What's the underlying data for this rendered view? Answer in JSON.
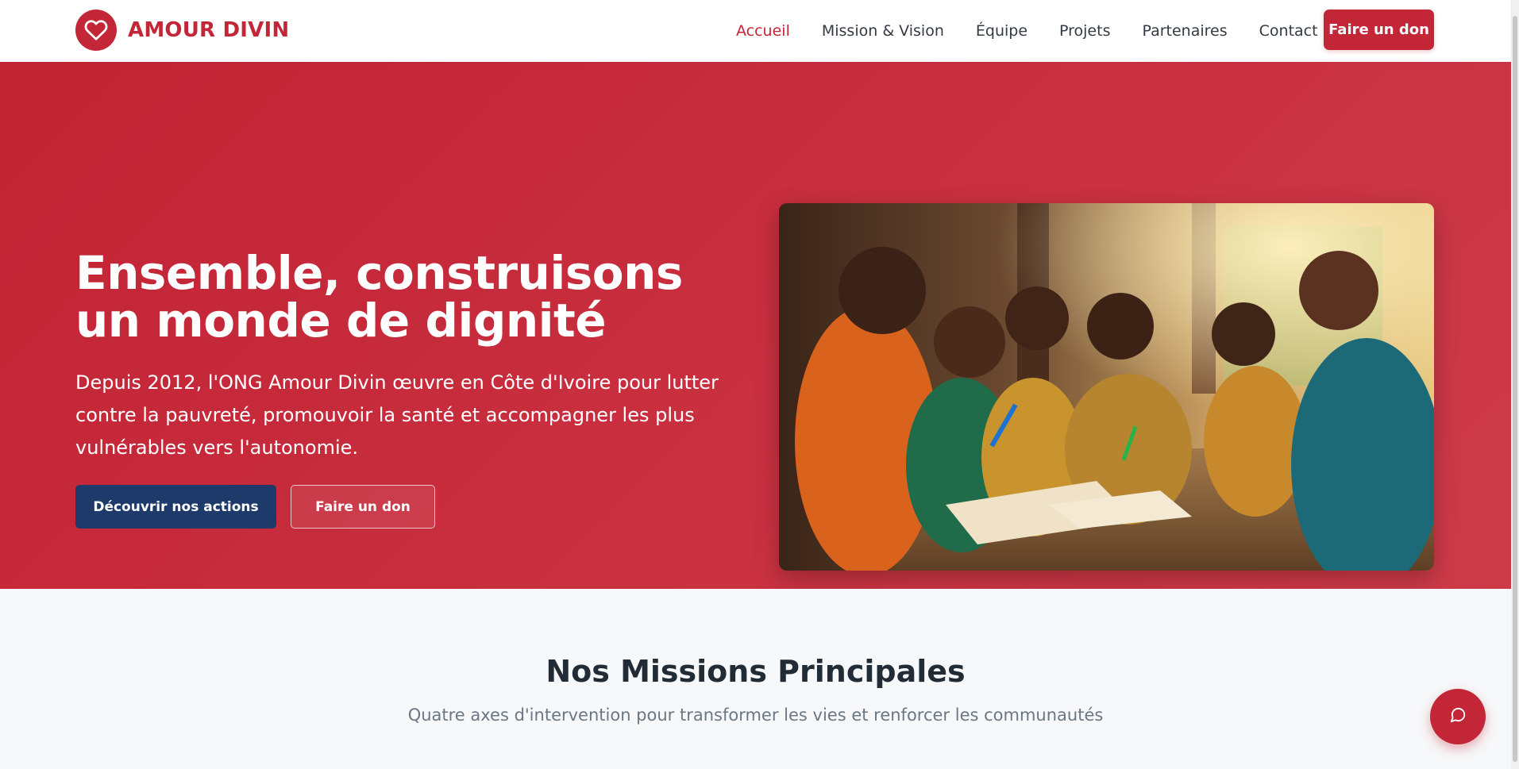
{
  "brand": {
    "name": "AMOUR DIVIN",
    "logo_icon": "heart-icon"
  },
  "nav": {
    "items": [
      {
        "label": "Accueil",
        "active": true
      },
      {
        "label": "Mission & Vision",
        "active": false
      },
      {
        "label": "Équipe",
        "active": false
      },
      {
        "label": "Projets",
        "active": false
      },
      {
        "label": "Partenaires",
        "active": false
      },
      {
        "label": "Contact",
        "active": false
      }
    ],
    "donate_label": "Faire un don"
  },
  "hero": {
    "title": "Ensemble, construisons un monde de dignité",
    "text": "Depuis 2012, l'ONG Amour Divin œuvre en Côte d'Ivoire pour lutter contre la pauvreté, promouvoir la santé et accompagner les plus vulnérables vers l'autonomie.",
    "primary_button": "Découvrir nos actions",
    "secondary_button": "Faire un don"
  },
  "missions": {
    "title": "Nos Missions Principales",
    "subtitle": "Quatre axes d'intervention pour transformer les vies et renforcer les communautés"
  },
  "chat": {
    "icon": "chat-bubble-icon"
  },
  "colors": {
    "brand_red": "#c32636",
    "navy": "#1e3a6b",
    "text_dark": "#222c36",
    "muted": "#6b7784"
  }
}
